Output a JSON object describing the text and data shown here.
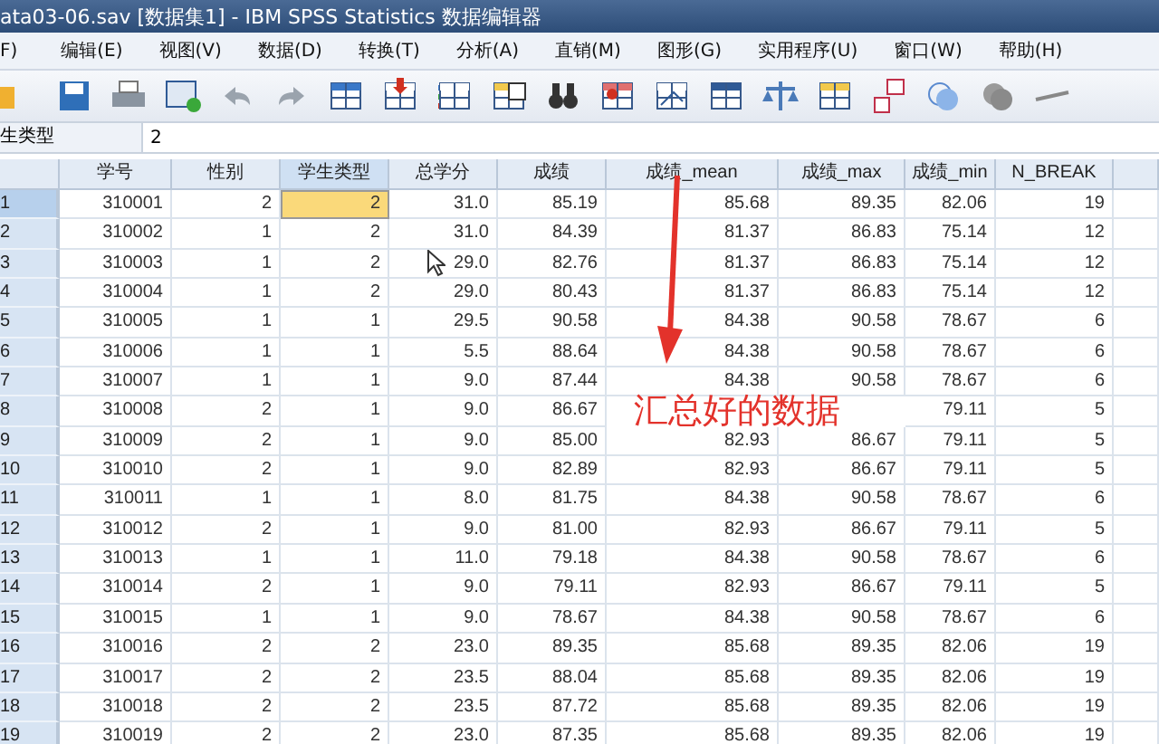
{
  "window": {
    "title": "ata03-06.sav [数据集1] - IBM SPSS Statistics 数据编辑器"
  },
  "menu": [
    "F)",
    "编辑(E)",
    "视图(V)",
    "数据(D)",
    "转换(T)",
    "分析(A)",
    "直销(M)",
    "图形(G)",
    "实用程序(U)",
    "窗口(W)",
    "帮助(H)"
  ],
  "cell_editor": {
    "variable": "生类型",
    "value": "2"
  },
  "table": {
    "columns": [
      {
        "label": "学号",
        "selected": false
      },
      {
        "label": "性别",
        "selected": false
      },
      {
        "label": "学生类型",
        "selected": true
      },
      {
        "label": "总学分",
        "selected": false
      },
      {
        "label": "成绩",
        "selected": false
      },
      {
        "label": "成绩_mean",
        "selected": false
      },
      {
        "label": "成绩_max",
        "selected": false
      },
      {
        "label": "成绩_min",
        "selected": false
      },
      {
        "label": "N_BREAK",
        "selected": false
      }
    ],
    "rows": [
      {
        "number": "1",
        "selected": true,
        "cells": [
          "310001",
          "2",
          "2",
          "31.0",
          "85.19",
          "85.68",
          "89.35",
          "82.06",
          "19"
        ]
      },
      {
        "number": "2",
        "selected": false,
        "cells": [
          "310002",
          "1",
          "2",
          "31.0",
          "84.39",
          "81.37",
          "86.83",
          "75.14",
          "12"
        ]
      },
      {
        "number": "3",
        "selected": false,
        "cells": [
          "310003",
          "1",
          "2",
          "29.0",
          "82.76",
          "81.37",
          "86.83",
          "75.14",
          "12"
        ]
      },
      {
        "number": "4",
        "selected": false,
        "cells": [
          "310004",
          "1",
          "2",
          "29.0",
          "80.43",
          "81.37",
          "86.83",
          "75.14",
          "12"
        ]
      },
      {
        "number": "5",
        "selected": false,
        "cells": [
          "310005",
          "1",
          "1",
          "29.5",
          "90.58",
          "84.38",
          "90.58",
          "78.67",
          "6"
        ]
      },
      {
        "number": "6",
        "selected": false,
        "cells": [
          "310006",
          "1",
          "1",
          "5.5",
          "88.64",
          "84.38",
          "90.58",
          "78.67",
          "6"
        ]
      },
      {
        "number": "7",
        "selected": false,
        "cells": [
          "310007",
          "1",
          "1",
          "9.0",
          "87.44",
          "84.38",
          "90.58",
          "78.67",
          "6"
        ]
      },
      {
        "number": "8",
        "selected": false,
        "cells": [
          "310008",
          "2",
          "1",
          "9.0",
          "86.67",
          null,
          null,
          "79.11",
          "5"
        ]
      },
      {
        "number": "9",
        "selected": false,
        "cells": [
          "310009",
          "2",
          "1",
          "9.0",
          "85.00",
          "82.93",
          "86.67",
          "79.11",
          "5"
        ]
      },
      {
        "number": "10",
        "selected": false,
        "cells": [
          "310010",
          "2",
          "1",
          "9.0",
          "82.89",
          "82.93",
          "86.67",
          "79.11",
          "5"
        ]
      },
      {
        "number": "11",
        "selected": false,
        "cells": [
          "310011",
          "1",
          "1",
          "8.0",
          "81.75",
          "84.38",
          "90.58",
          "78.67",
          "6"
        ]
      },
      {
        "number": "12",
        "selected": false,
        "cells": [
          "310012",
          "2",
          "1",
          "9.0",
          "81.00",
          "82.93",
          "86.67",
          "79.11",
          "5"
        ]
      },
      {
        "number": "13",
        "selected": false,
        "cells": [
          "310013",
          "1",
          "1",
          "11.0",
          "79.18",
          "84.38",
          "90.58",
          "78.67",
          "6"
        ]
      },
      {
        "number": "14",
        "selected": false,
        "cells": [
          "310014",
          "2",
          "1",
          "9.0",
          "79.11",
          "82.93",
          "86.67",
          "79.11",
          "5"
        ]
      },
      {
        "number": "15",
        "selected": false,
        "cells": [
          "310015",
          "1",
          "1",
          "9.0",
          "78.67",
          "84.38",
          "90.58",
          "78.67",
          "6"
        ]
      },
      {
        "number": "16",
        "selected": false,
        "cells": [
          "310016",
          "2",
          "2",
          "23.0",
          "89.35",
          "85.68",
          "89.35",
          "82.06",
          "19"
        ]
      },
      {
        "number": "17",
        "selected": false,
        "cells": [
          "310017",
          "2",
          "2",
          "23.5",
          "88.04",
          "85.68",
          "89.35",
          "82.06",
          "19"
        ]
      },
      {
        "number": "18",
        "selected": false,
        "cells": [
          "310018",
          "2",
          "2",
          "23.5",
          "87.72",
          "85.68",
          "89.35",
          "82.06",
          "19"
        ]
      },
      {
        "number": "19",
        "selected": false,
        "cells": [
          "310019",
          "2",
          "2",
          "23.0",
          "87.35",
          "85.68",
          "89.35",
          "82.06",
          "19"
        ]
      }
    ]
  },
  "annotation": {
    "text": "汇总好的数据"
  }
}
